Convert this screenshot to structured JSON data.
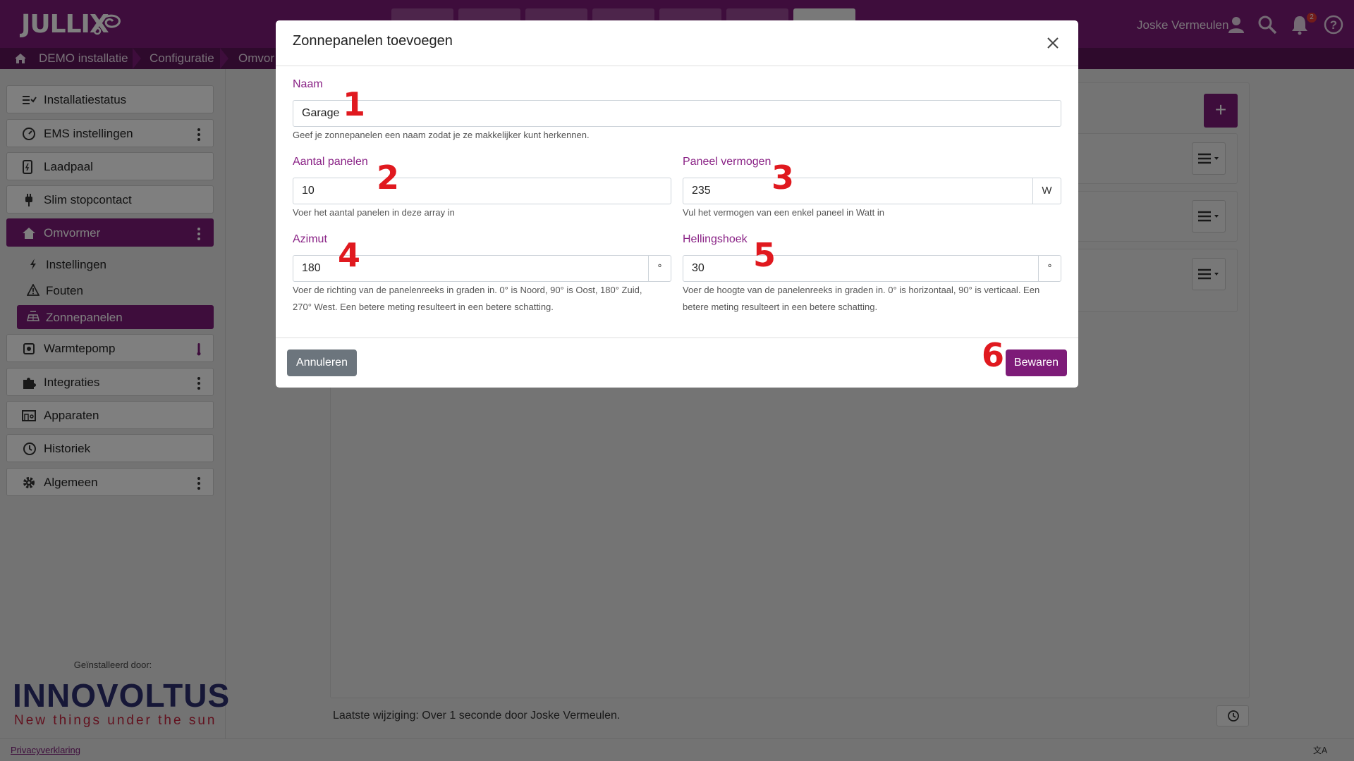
{
  "app": {
    "logo": "JULLIX",
    "user_name": "Joske Vermeulen",
    "notification_count": "2",
    "accent_color": "#7d1b78"
  },
  "breadcrumb": [
    "DEMO installatie",
    "Configuratie",
    "Omvor"
  ],
  "sidebar": {
    "items": [
      {
        "label": "Installatiestatus",
        "icon": "checklist-icon"
      },
      {
        "label": "EMS instellingen",
        "icon": "gauge-icon"
      },
      {
        "label": "Laadpaal",
        "icon": "charger-icon"
      },
      {
        "label": "Slim stopcontact",
        "icon": "plug-icon"
      },
      {
        "label": "Omvormer",
        "icon": "house-icon"
      },
      {
        "label": "Warmtepomp",
        "icon": "heatpump-icon"
      },
      {
        "label": "Integraties",
        "icon": "puzzle-icon"
      },
      {
        "label": "Apparaten",
        "icon": "devices-icon"
      },
      {
        "label": "Historiek",
        "icon": "history-icon"
      },
      {
        "label": "Algemeen",
        "icon": "gear-icon"
      }
    ],
    "subitems": [
      {
        "label": "Instellingen",
        "icon": "bolt-icon"
      },
      {
        "label": "Fouten",
        "icon": "warning-icon"
      },
      {
        "label": "Zonnepanelen",
        "icon": "solar-panel-icon"
      }
    ],
    "installed_by": "Geïnstalleerd door:",
    "brand": "INNOVOLTUS",
    "brand_tagline": "New things under the sun"
  },
  "main": {
    "last_change": "Laatste wijziging: Over 1 seconde door Joske Vermeulen."
  },
  "footer": {
    "privacy": "Privacyverklaring"
  },
  "modal": {
    "title": "Zonnepanelen toevoegen",
    "fields": {
      "naam": {
        "label": "Naam",
        "value": "Garage",
        "help": "Geef je zonnepanelen een naam zodat je ze makkelijker kunt herkennen."
      },
      "aantal": {
        "label": "Aantal panelen",
        "value": "10",
        "help": "Voer het aantal panelen in deze array in"
      },
      "vermogen": {
        "label": "Paneel vermogen",
        "value": "235",
        "unit": "W",
        "help": "Vul het vermogen van een enkel paneel in Watt in"
      },
      "azimut": {
        "label": "Azimut",
        "value": "180",
        "unit": "°",
        "help_line1": "Voer de richting van de panelenreeks in graden in. 0° is Noord, 90° is Oost, 180° Zuid,",
        "help_line2": "270° West. Een betere meting resulteert in een betere schatting."
      },
      "helling": {
        "label": "Hellingshoek",
        "value": "30",
        "unit": "°",
        "help_line1": "Voer de hoogte van de panelenreeks in graden in. 0° is horizontaal, 90° is verticaal. Een",
        "help_line2": "betere meting resulteert in een betere schatting."
      }
    },
    "cancel_label": "Annuleren",
    "save_label": "Bewaren",
    "markers": [
      "1",
      "2",
      "3",
      "4",
      "5",
      "6"
    ]
  }
}
